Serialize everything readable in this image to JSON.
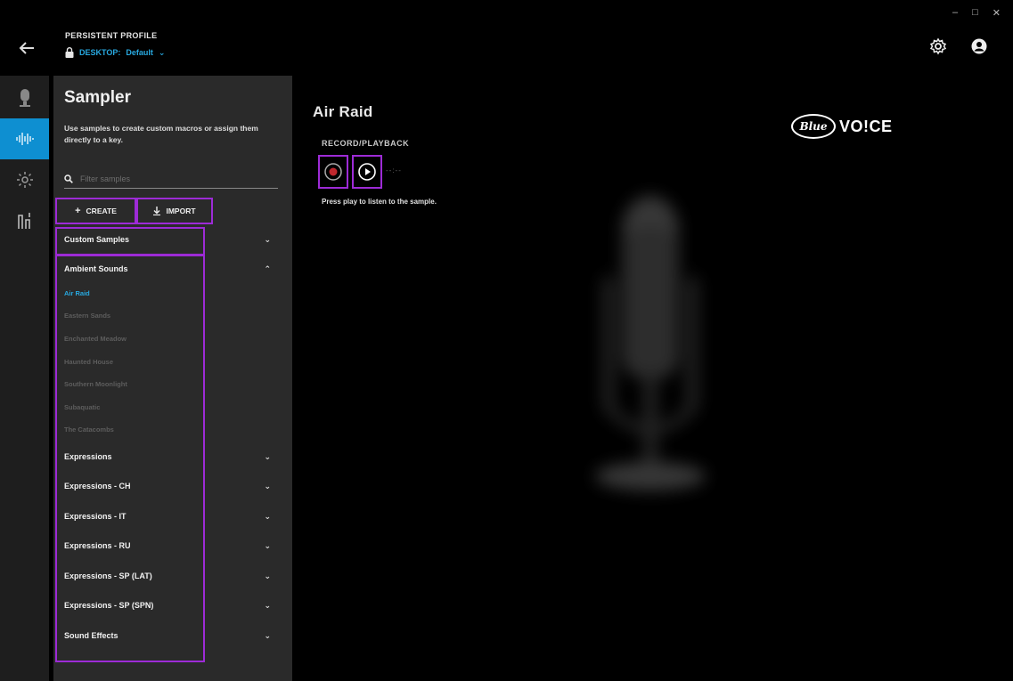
{
  "header": {
    "back_icon": "arrow-left-icon",
    "profile_label": "PERSISTENT PROFILE",
    "profile_device": "DESKTOP:",
    "profile_name": "Default",
    "window_controls": [
      "–",
      "□",
      "✕"
    ],
    "settings_icon": "gear-icon",
    "account_icon": "user-icon"
  },
  "rail": {
    "items": [
      {
        "icon": "microphone-icon",
        "active": false
      },
      {
        "icon": "waveform-icon",
        "active": true
      },
      {
        "icon": "light-icon",
        "active": false
      },
      {
        "icon": "equalizer-icon",
        "active": false
      }
    ]
  },
  "panel": {
    "title": "Sampler",
    "description": "Use samples to create custom macros or assign them directly to a key.",
    "search_placeholder": "Filter samples",
    "create_label": "CREATE",
    "import_label": "IMPORT",
    "categories": {
      "custom": "Custom Samples",
      "ambient": "Ambient Sounds",
      "expressions": "Expressions",
      "expressions_ch": "Expressions - CH",
      "expressions_it": "Expressions - IT",
      "expressions_ru": "Expressions - RU",
      "expressions_sp_lat": "Expressions - SP (LAT)",
      "expressions_sp_spn": "Expressions - SP (SPN)",
      "sound_effects": "Sound Effects"
    },
    "ambient_items": [
      "Air Raid",
      "Eastern Sands",
      "Enchanted Meadow",
      "Haunted House",
      "Southern Moonlight",
      "Subaquatic",
      "The Catacombs"
    ]
  },
  "main": {
    "title": "Air Raid",
    "record_playback_label": "RECORD/PLAYBACK",
    "time": "--:--",
    "hint": "Press play to listen to the sample.",
    "brand_blue": "Blue",
    "brand_voice": "VO!CE"
  },
  "colors": {
    "accent": "#0e8fd1",
    "link": "#28a9e0",
    "highlight_box": "#9d2bd6",
    "record": "#c0272d"
  }
}
